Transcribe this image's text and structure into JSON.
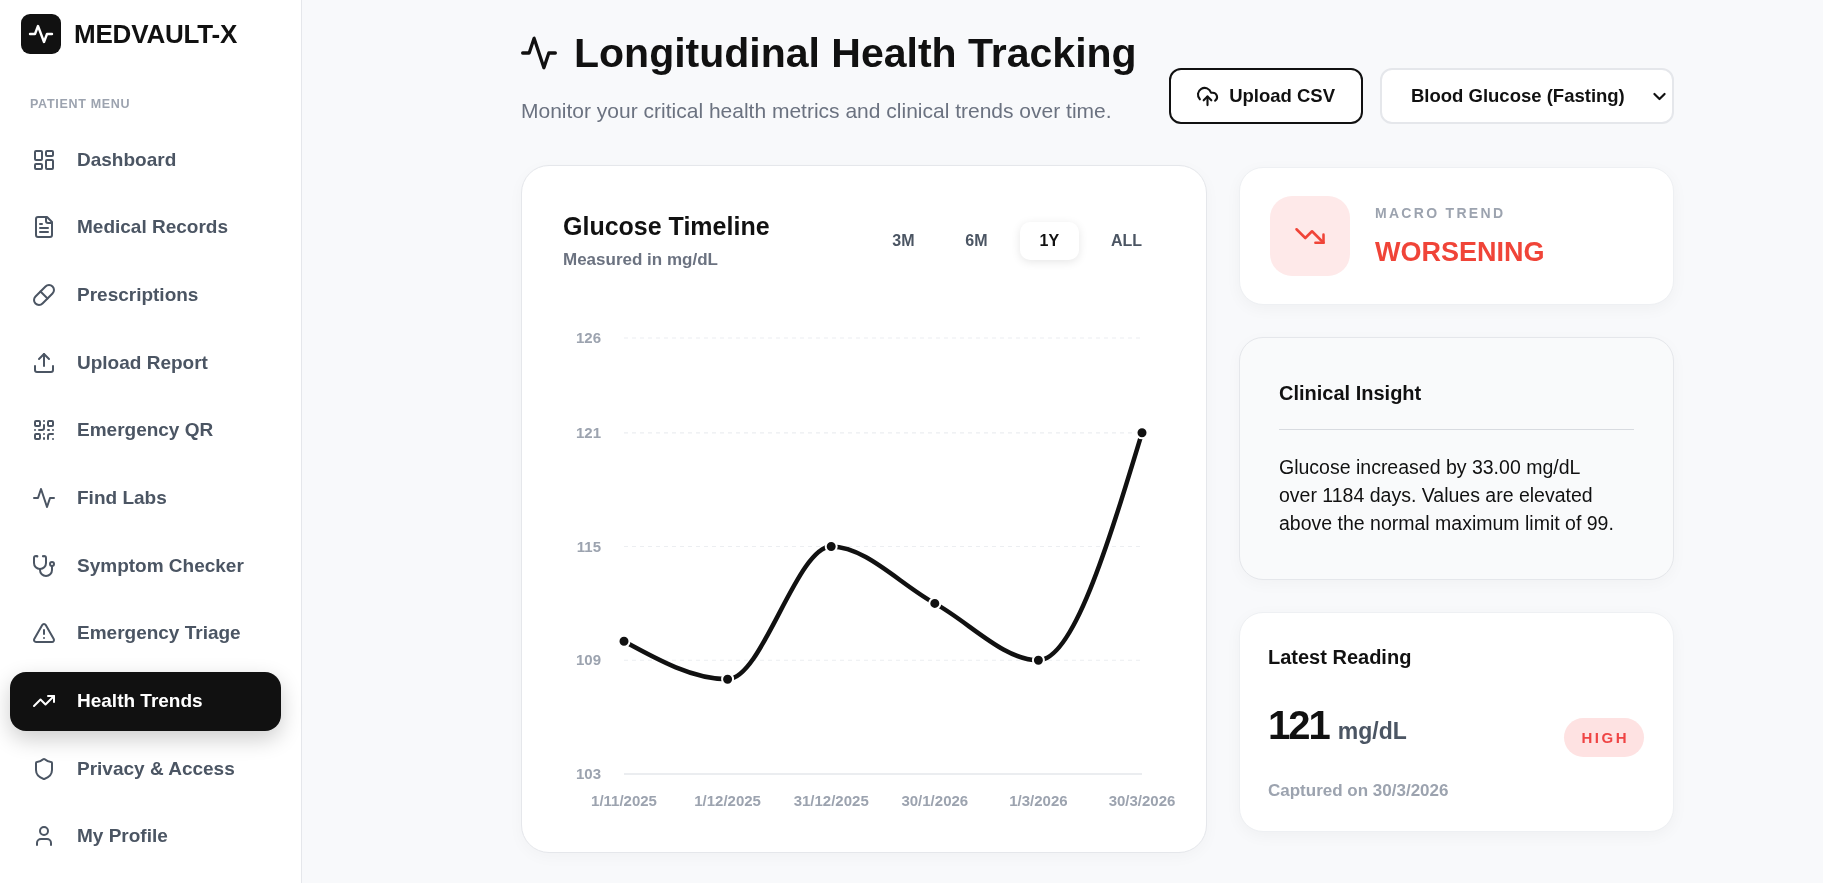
{
  "sidebar": {
    "brand": "MEDVAULT-X",
    "section_label": "PATIENT MENU",
    "items": [
      {
        "label": "Dashboard",
        "selected": false
      },
      {
        "label": "Medical Records",
        "selected": false
      },
      {
        "label": "Prescriptions",
        "selected": false
      },
      {
        "label": "Upload Report",
        "selected": false
      },
      {
        "label": "Emergency QR",
        "selected": false
      },
      {
        "label": "Find Labs",
        "selected": false
      },
      {
        "label": "Symptom Checker",
        "selected": false
      },
      {
        "label": "Emergency Triage",
        "selected": false
      },
      {
        "label": "Health Trends",
        "selected": true
      },
      {
        "label": "Privacy & Access",
        "selected": false
      },
      {
        "label": "My Profile",
        "selected": false
      }
    ]
  },
  "header": {
    "title": "Longitudinal Health Tracking",
    "subtitle": "Monitor your critical health metrics and clinical trends over time.",
    "upload_button": "Upload CSV",
    "metric_select": {
      "value": "Blood Glucose (Fasting)"
    }
  },
  "timeline_card": {
    "title": "Glucose Timeline",
    "subtitle": "Measured in mg/dL",
    "ranges": [
      {
        "label": "3M",
        "selected": false
      },
      {
        "label": "6M",
        "selected": false
      },
      {
        "label": "1Y",
        "selected": true
      },
      {
        "label": "ALL",
        "selected": false
      }
    ],
    "chart_data": {
      "type": "line",
      "categories": [
        "1/11/2025",
        "1/12/2025",
        "31/12/2025",
        "30/1/2026",
        "1/3/2026",
        "30/3/2026"
      ],
      "values": [
        110,
        108,
        115,
        112,
        109,
        121
      ],
      "ylim": [
        103,
        126
      ],
      "yticks": [
        103,
        109,
        115,
        121,
        126
      ],
      "grid": true,
      "marker": "circle"
    }
  },
  "trend_card": {
    "label": "MACRO TREND",
    "value": "WORSENING"
  },
  "insight_card": {
    "title": "Clinical Insight",
    "text": "Glucose increased by 33.00 mg/dL over 1184 days. Values are elevated above the normal maximum limit of 99."
  },
  "reading_card": {
    "title": "Latest Reading",
    "value": "121",
    "unit": "mg/dL",
    "badge": "HIGH",
    "caption": "Captured on 30/3/2026"
  }
}
